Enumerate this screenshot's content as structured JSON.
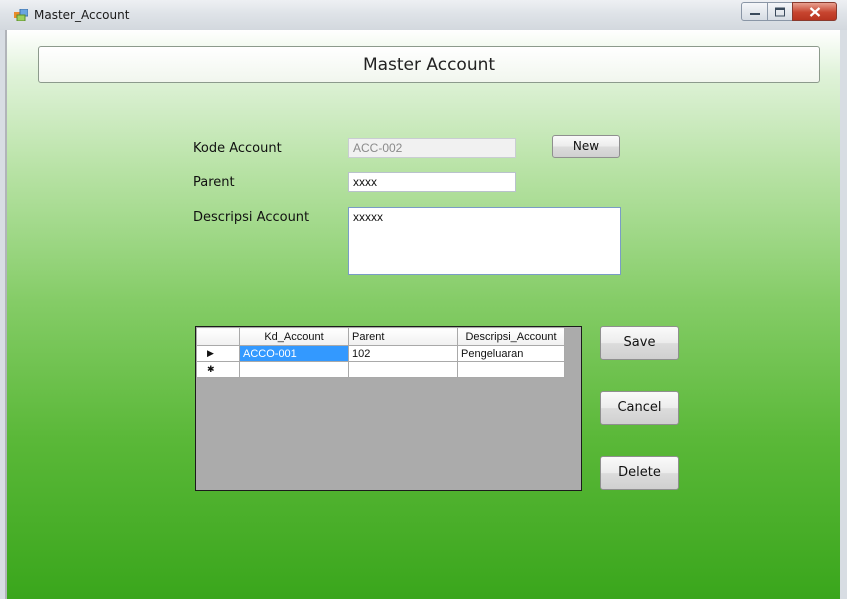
{
  "window": {
    "title": "Master_Account",
    "icon": "form-icon"
  },
  "header": {
    "title": "Master Account"
  },
  "form": {
    "kode_label": "Kode Account",
    "kode_value": "ACC-002",
    "new_button": "New",
    "parent_label": "Parent",
    "parent_value": "xxxx",
    "descripsi_label": "Descripsi Account",
    "descripsi_value": "xxxxx"
  },
  "grid": {
    "columns": [
      "Kd_Account",
      "Parent",
      "Descripsi_Account"
    ],
    "rows": [
      {
        "indicator": "▶",
        "cells": [
          "ACCO-001",
          "102",
          "Pengeluaran"
        ]
      },
      {
        "indicator": "✱",
        "cells": [
          "",
          "",
          ""
        ]
      }
    ]
  },
  "actions": {
    "save": "Save",
    "cancel": "Cancel",
    "delete": "Delete"
  }
}
